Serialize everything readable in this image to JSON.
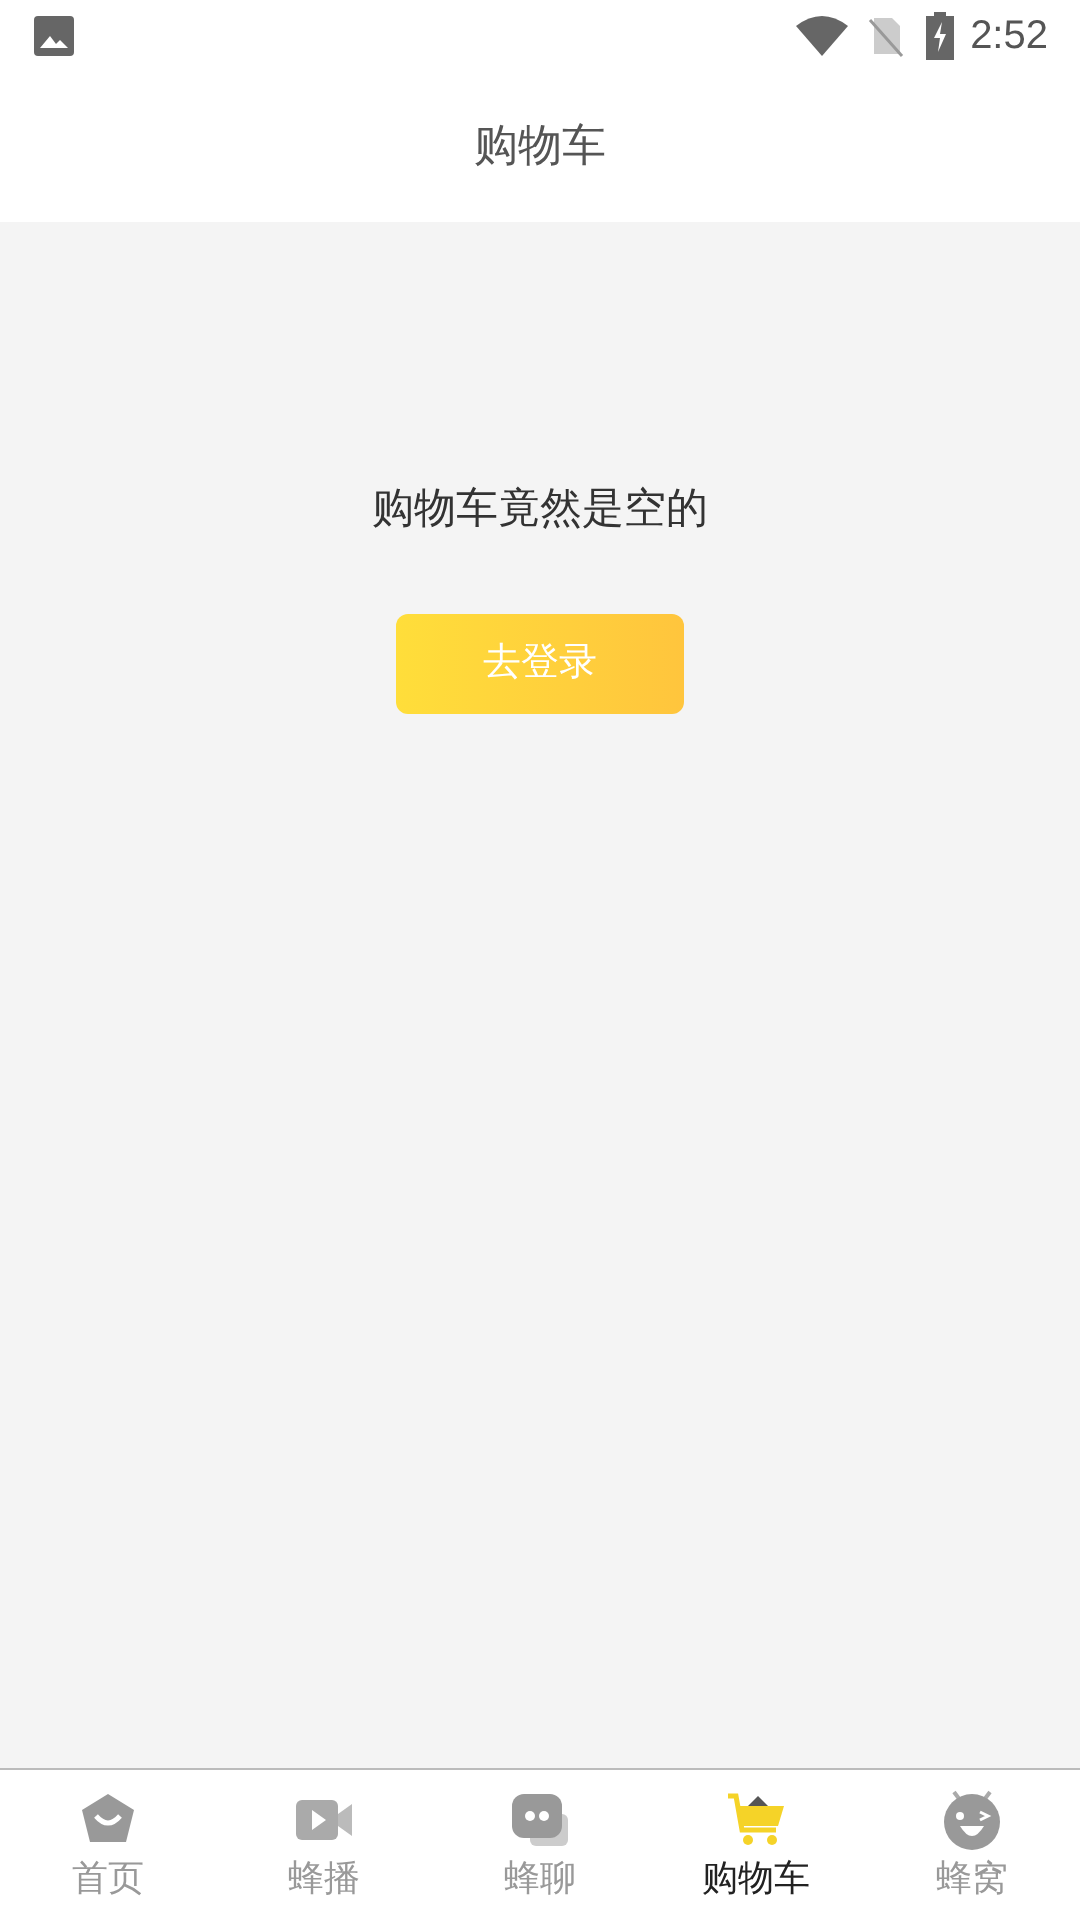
{
  "status_bar": {
    "time": "2:52"
  },
  "header": {
    "title": "购物车"
  },
  "empty_state": {
    "message": "购物车竟然是空的",
    "button": "去登录"
  },
  "tabs": [
    {
      "label": "首页",
      "kind": "home",
      "selected": false
    },
    {
      "label": "蜂播",
      "kind": "video",
      "selected": false
    },
    {
      "label": "蜂聊",
      "kind": "chat",
      "selected": false
    },
    {
      "label": "购物车",
      "kind": "cart",
      "selected": true
    },
    {
      "label": "蜂窝",
      "kind": "profile",
      "selected": false
    }
  ]
}
